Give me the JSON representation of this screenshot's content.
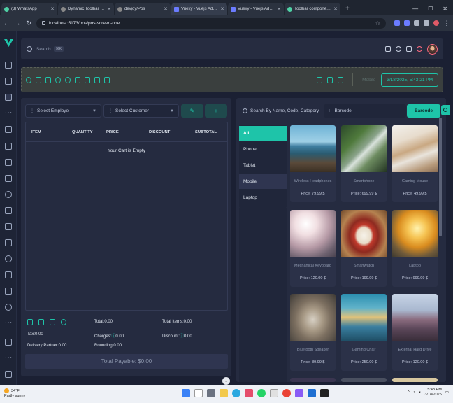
{
  "browser": {
    "tabs": [
      {
        "title": "(3) WhatsApp",
        "icon": "whatsapp-icon"
      },
      {
        "title": "Dynamic Toolbar Background C",
        "icon": "github-icon"
      },
      {
        "title": "devjoy/Pos",
        "icon": "github-icon"
      },
      {
        "title": "Vuexy - Vuejs Admin Dashboard",
        "icon": "vuexy-icon"
      },
      {
        "title": "Vuexy - Vuejs Admin Dashboar",
        "icon": "vuexy-icon"
      },
      {
        "title": "Toolbar component — Vuetify",
        "icon": "vuetify-icon"
      }
    ],
    "active_tab": 3,
    "url": "localhost:5173/pos/pos-screen-one"
  },
  "topbar": {
    "search_placeholder": "Search",
    "search_shortcut": "⌘K"
  },
  "toolbar": {
    "mode_label": "Mobile",
    "datetime": "3/18/2025, 5:43:21 PM"
  },
  "cart": {
    "employee_placeholder": "Select Employe",
    "customer_placeholder": "Select Customer",
    "columns": [
      "ITEM",
      "QUANTITY",
      "PRICE",
      "DISCOUNT",
      "SUBTOTAL"
    ],
    "empty_message": "Your Cart is Empty",
    "summary": {
      "total": "Total:0.00",
      "total_items": "Total Items:0.00",
      "tax": "Tax:0.00",
      "charges": "Charges:",
      "charges_value": "0.00",
      "discount": "Discount:",
      "discount_value": "0.00",
      "delivery": "Delivery Partner:0.00",
      "rounding": "Rounding:0.00"
    },
    "payable": "Total Payable: $0.00"
  },
  "products": {
    "search_placeholder": "Search By Name, Code, Category",
    "barcode_placeholder": "Barcode",
    "barcode_button": "Barcode",
    "categories": [
      "All",
      "Phone",
      "Tablet",
      "Mobile",
      "Laptop"
    ],
    "active_category": 0,
    "items": [
      {
        "name": "Wireless Headphones",
        "price": "Price: 79.99 $"
      },
      {
        "name": "Smartphone",
        "price": "Price: 699.99 $"
      },
      {
        "name": "Gaming Mouse",
        "price": "Price: 49.99 $"
      },
      {
        "name": "Mechanical Keyboard",
        "price": "Price: 120.00 $"
      },
      {
        "name": "Smartwatch",
        "price": "Price: 199.99 $"
      },
      {
        "name": "Laptop",
        "price": "Price: 999.99 $"
      },
      {
        "name": "Bluetooth Speaker",
        "price": "Price: 89.99 $"
      },
      {
        "name": "Gaming Chair",
        "price": "Price: 250.00 $"
      },
      {
        "name": "External Hard Drive",
        "price": "Price: 120.00 $"
      }
    ]
  },
  "taskbar": {
    "temperature": "34°F",
    "weather": "Partly sunny",
    "time": "5:43 PM",
    "date": "3/18/2025"
  },
  "colors": {
    "accent": "#1ec4a9",
    "background": "#1b2033",
    "panel": "#252b40"
  }
}
